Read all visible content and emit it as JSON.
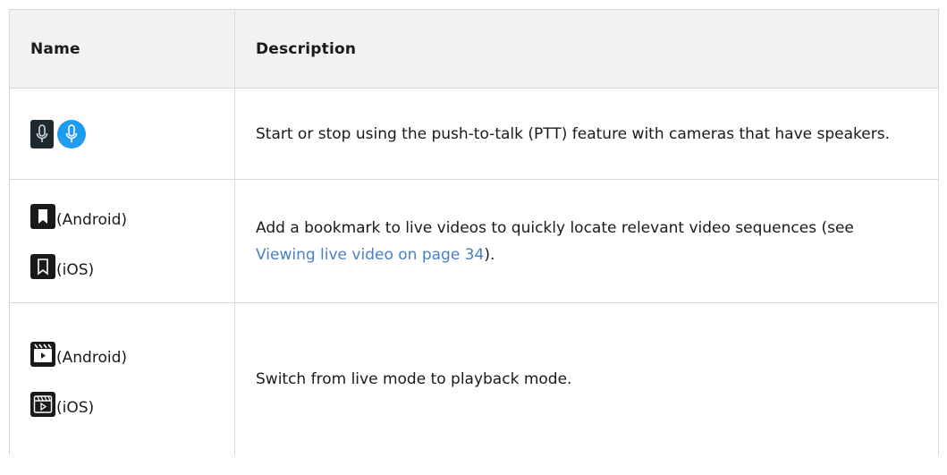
{
  "table": {
    "headers": {
      "name": "Name",
      "description": "Description"
    },
    "rows": [
      {
        "icons": [
          "microphone-icon",
          "microphone-active-icon"
        ],
        "description": "Start or stop using the push-to-talk (PTT) feature with cameras that have speakers."
      },
      {
        "android_label": "(Android)",
        "ios_label": "(iOS)",
        "icons": [
          "bookmark-filled-icon",
          "bookmark-outline-icon"
        ],
        "description_before": "Add a bookmark to live videos to quickly locate relevant video sequences (see ",
        "link_text": "Viewing live video on page 34",
        "description_after": ")."
      },
      {
        "android_label": "(Android)",
        "ios_label": "(iOS)",
        "icons": [
          "playback-filled-icon",
          "playback-outline-icon"
        ],
        "description": "Switch from live mode to playback mode."
      }
    ]
  },
  "colors": {
    "header_bg": "#f2f2f2",
    "border": "#d9d9d9",
    "link": "#4a7fc1",
    "mic_active": "#1f9bf0",
    "icon_dark": "#1e2a30"
  }
}
